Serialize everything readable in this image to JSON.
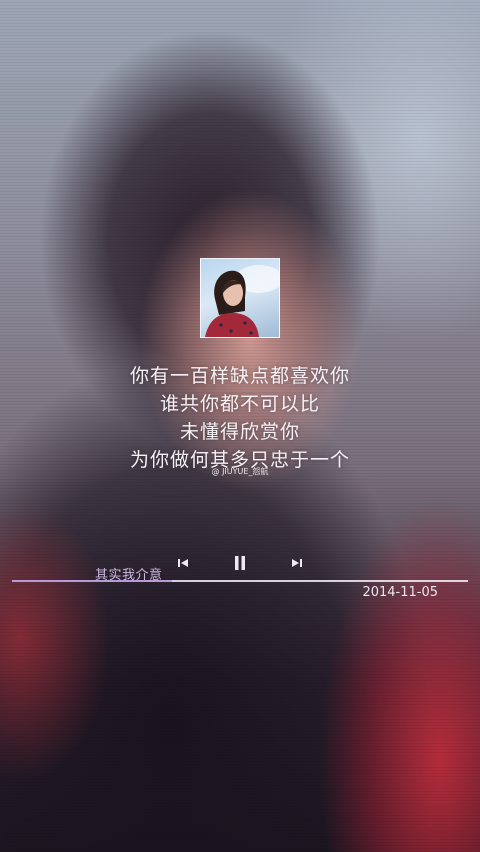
{
  "song": {
    "title": "其实我介意",
    "date": "2014-11-05",
    "progress": 0.35
  },
  "lyrics": [
    "你有一百样缺点都喜欢你",
    "谁共你都不可以比",
    "未懂得欣赏你",
    "为你做何其多只忠于一个"
  ],
  "credit": "@ JIUYUE_怨航",
  "controls": {
    "prev_icon": "skip-previous-icon",
    "pause_icon": "pause-icon",
    "next_icon": "skip-next-icon"
  },
  "colors": {
    "accent": "#b89ad8",
    "text": "#f6f1f6"
  }
}
